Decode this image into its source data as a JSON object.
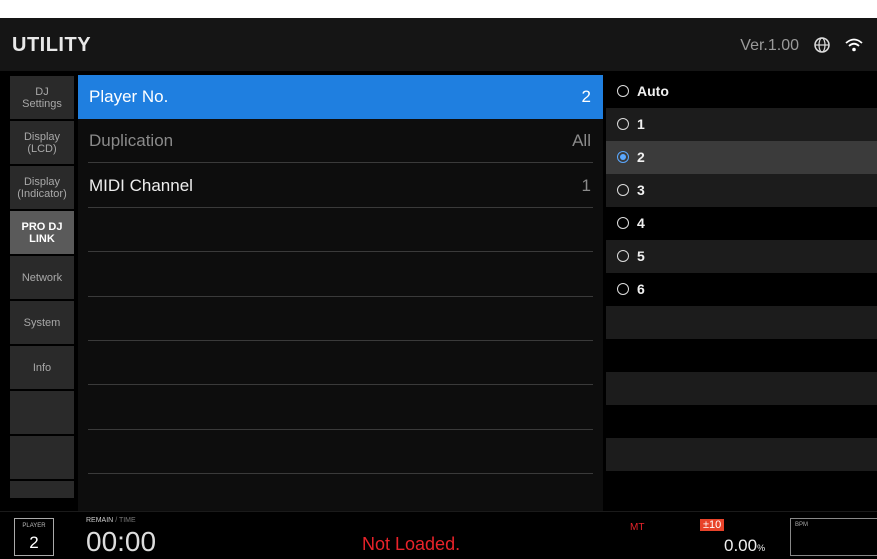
{
  "header": {
    "title": "UTILITY",
    "version": "Ver.1.00"
  },
  "tabs": [
    {
      "label": "DJ\nSettings"
    },
    {
      "label": "Display\n(LCD)"
    },
    {
      "label": "Display\n(Indicator)"
    },
    {
      "label": "PRO DJ\nLINK",
      "active": true
    },
    {
      "label": "Network"
    },
    {
      "label": "System"
    },
    {
      "label": "Info"
    },
    {
      "label": ""
    },
    {
      "label": ""
    },
    {
      "label": ""
    }
  ],
  "settings": [
    {
      "label": "Player No.",
      "value": "2",
      "state": "selected"
    },
    {
      "label": "Duplication",
      "value": "All",
      "state": "dimmed"
    },
    {
      "label": "MIDI Channel",
      "value": "1",
      "state": "normal"
    }
  ],
  "options": [
    {
      "label": "Auto",
      "selected": false
    },
    {
      "label": "1",
      "selected": false
    },
    {
      "label": "2",
      "selected": true
    },
    {
      "label": "3",
      "selected": false
    },
    {
      "label": "4",
      "selected": false
    },
    {
      "label": "5",
      "selected": false
    },
    {
      "label": "6",
      "selected": false
    }
  ],
  "footer": {
    "player_label": "PLAYER",
    "player_number": "2",
    "remain_label": "REMAIN",
    "time_label": "/ TIME",
    "time": "00:00",
    "status": "Not Loaded.",
    "mt_label": "MT",
    "tempo_range": "±10",
    "pitch": "0.00",
    "pitch_unit": "%",
    "bpm_label": "BPM"
  },
  "colors": {
    "accent": "#1f7fe0",
    "alert": "#e8232a",
    "radio_selected": "#5aa8ff"
  }
}
